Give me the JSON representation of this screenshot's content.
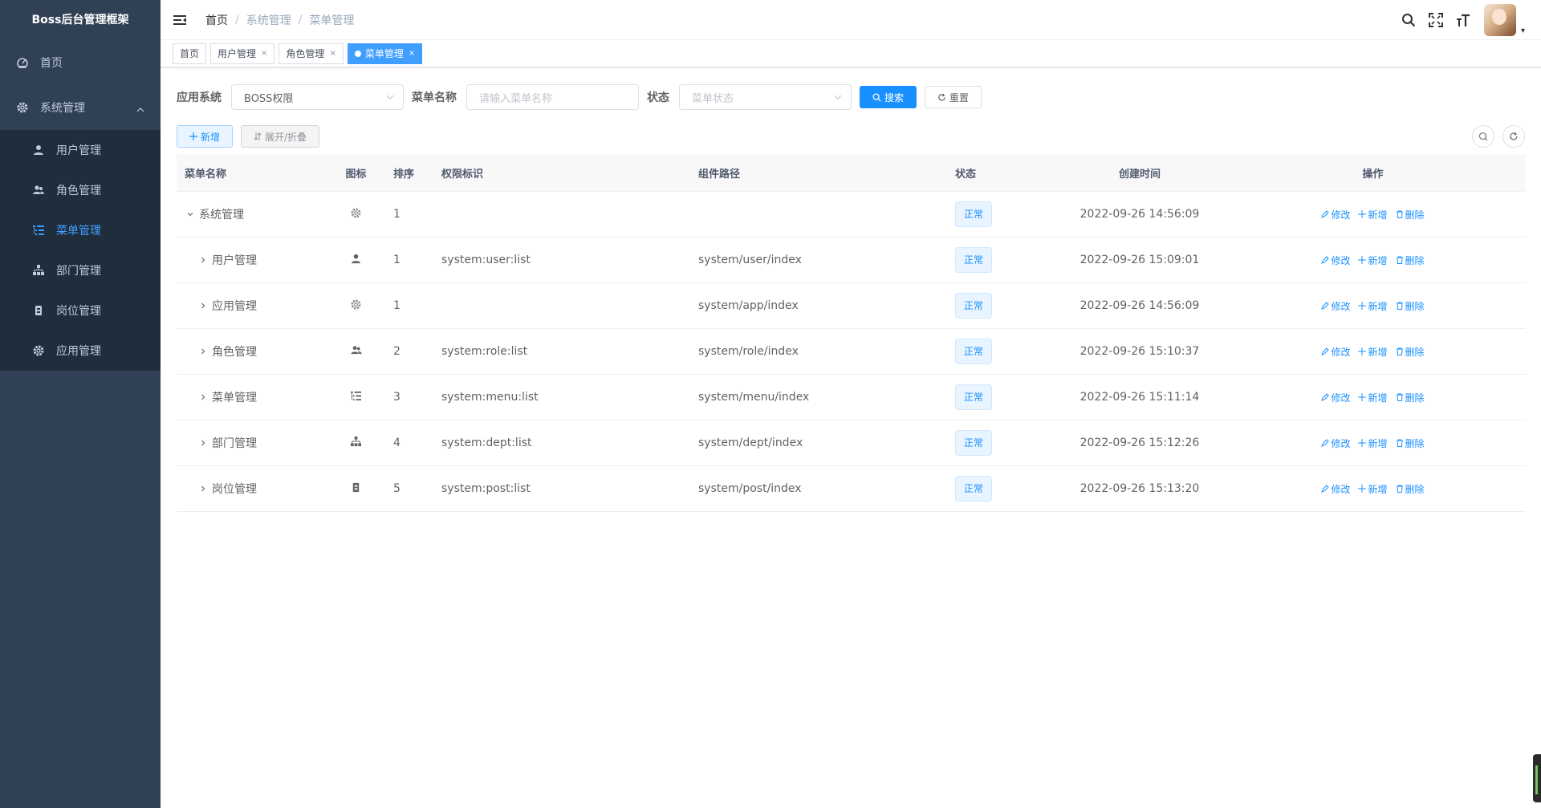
{
  "app": {
    "title": "Boss后台管理框架"
  },
  "sidebar": {
    "items": [
      {
        "label": "首页",
        "icon": "dashboard-icon"
      },
      {
        "label": "系统管理",
        "icon": "gear-icon"
      }
    ],
    "submenu": [
      {
        "label": "用户管理",
        "icon": "user-icon"
      },
      {
        "label": "角色管理",
        "icon": "peoples-icon"
      },
      {
        "label": "菜单管理",
        "icon": "tree-table-icon",
        "active": true
      },
      {
        "label": "部门管理",
        "icon": "tree-icon"
      },
      {
        "label": "岗位管理",
        "icon": "post-icon"
      },
      {
        "label": "应用管理",
        "icon": "gear-icon"
      }
    ]
  },
  "breadcrumb": [
    "首页",
    "系统管理",
    "菜单管理"
  ],
  "breadcrumb_sep": "/",
  "tags": [
    {
      "label": "首页"
    },
    {
      "label": "用户管理",
      "close": "×"
    },
    {
      "label": "角色管理",
      "close": "×"
    },
    {
      "label": "菜单管理",
      "close": "×",
      "active": true
    }
  ],
  "search": {
    "app_label": "应用系统",
    "app_value": "BOSS权限",
    "name_label": "菜单名称",
    "name_placeholder": "请输入菜单名称",
    "status_label": "状态",
    "status_placeholder": "菜单状态",
    "search_btn": "搜索",
    "reset_btn": "重置"
  },
  "toolbar": {
    "add_btn": "新增",
    "toggle_btn": "展开/折叠"
  },
  "table": {
    "headers": {
      "name": "菜单名称",
      "icon": "图标",
      "sort": "排序",
      "perm": "权限标识",
      "component": "组件路径",
      "status": "状态",
      "created": "创建时间",
      "ops": "操作"
    },
    "rows": [
      {
        "name": "系统管理",
        "icon": "gear-icon",
        "sort": "1",
        "perm": "",
        "component": "",
        "status": "正常",
        "created": "2022-09-26 14:56:09",
        "expanded": true
      },
      {
        "name": "用户管理",
        "icon": "user-icon",
        "sort": "1",
        "perm": "system:user:list",
        "component": "system/user/index",
        "status": "正常",
        "created": "2022-09-26 15:09:01"
      },
      {
        "name": "应用管理",
        "icon": "gear-icon",
        "sort": "1",
        "perm": "",
        "component": "system/app/index",
        "status": "正常",
        "created": "2022-09-26 14:56:09"
      },
      {
        "name": "角色管理",
        "icon": "peoples-icon",
        "sort": "2",
        "perm": "system:role:list",
        "component": "system/role/index",
        "status": "正常",
        "created": "2022-09-26 15:10:37"
      },
      {
        "name": "菜单管理",
        "icon": "tree-table-icon",
        "sort": "3",
        "perm": "system:menu:list",
        "component": "system/menu/index",
        "status": "正常",
        "created": "2022-09-26 15:11:14"
      },
      {
        "name": "部门管理",
        "icon": "tree-icon",
        "sort": "4",
        "perm": "system:dept:list",
        "component": "system/dept/index",
        "status": "正常",
        "created": "2022-09-26 15:12:26"
      },
      {
        "name": "岗位管理",
        "icon": "post-icon",
        "sort": "5",
        "perm": "system:post:list",
        "component": "system/post/index",
        "status": "正常",
        "created": "2022-09-26 15:13:20"
      }
    ],
    "ops": {
      "edit": "修改",
      "add": "新增",
      "delete": "删除"
    }
  },
  "colors": {
    "sidebar_bg": "#304156",
    "submenu_bg": "#1f2d3d",
    "accent": "#1890ff",
    "active_menu": "#409eff"
  }
}
